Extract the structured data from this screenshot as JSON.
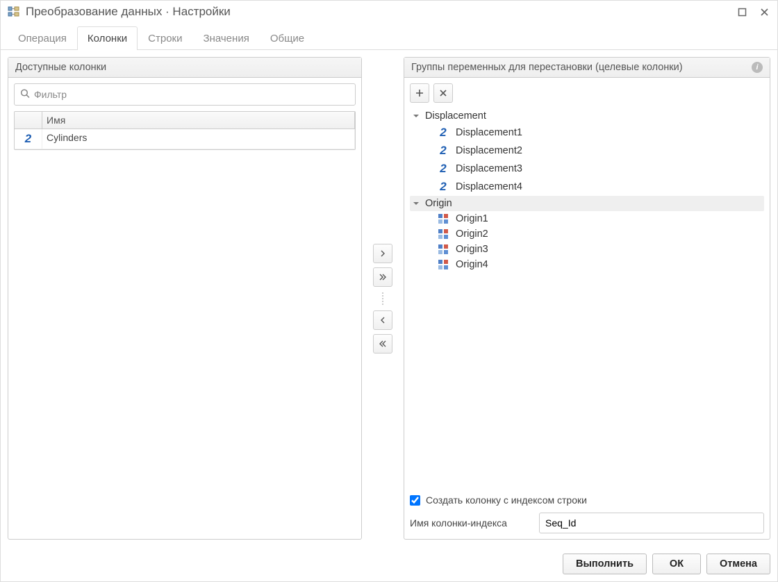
{
  "window": {
    "title": "Преобразование данных · Настройки"
  },
  "tabs": {
    "t0": "Операция",
    "t1": "Колонки",
    "t2": "Строки",
    "t3": "Значения",
    "t4": "Общие",
    "active": 1
  },
  "left_panel": {
    "title": "Доступные колонки",
    "filter_placeholder": "Фильтр",
    "header_name": "Имя",
    "rows": {
      "r0": {
        "icon": "numeric",
        "label": "Cylinders"
      }
    }
  },
  "right_panel": {
    "title": "Группы переменных для перестановки (целевые колонки)",
    "groups": {
      "g0": {
        "label": "Displacement",
        "selected": false,
        "items": {
          "i0": {
            "icon": "numeric",
            "label": "Displacement1"
          },
          "i1": {
            "icon": "numeric",
            "label": "Displacement2"
          },
          "i2": {
            "icon": "numeric",
            "label": "Displacement3"
          },
          "i3": {
            "icon": "numeric",
            "label": "Displacement4"
          }
        }
      },
      "g1": {
        "label": "Origin",
        "selected": true,
        "items": {
          "i0": {
            "icon": "categorical",
            "label": "Origin1"
          },
          "i1": {
            "icon": "categorical",
            "label": "Origin2"
          },
          "i2": {
            "icon": "categorical",
            "label": "Origin3"
          },
          "i3": {
            "icon": "categorical",
            "label": "Origin4"
          }
        }
      }
    },
    "create_index_label": "Создать колонку с индексом строки",
    "create_index_checked": true,
    "index_name_label": "Имя колонки-индекса",
    "index_name_value": "Seq_Id"
  },
  "footer": {
    "run": "Выполнить",
    "ok": "ОК",
    "cancel": "Отмена"
  }
}
